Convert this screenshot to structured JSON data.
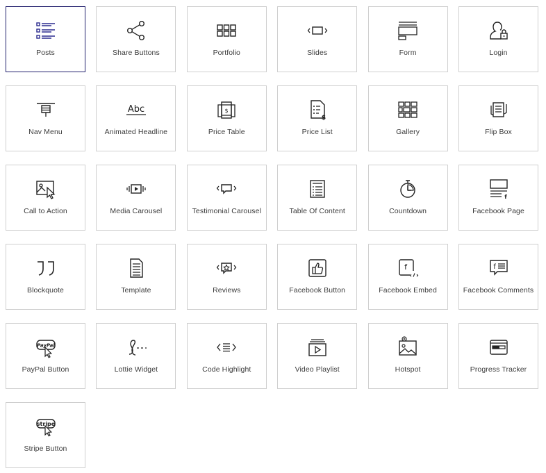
{
  "widgets": [
    {
      "label": "Posts",
      "icon": "posts-icon",
      "selected": true
    },
    {
      "label": "Share Buttons",
      "icon": "share-icon"
    },
    {
      "label": "Portfolio",
      "icon": "portfolio-grid-icon"
    },
    {
      "label": "Slides",
      "icon": "slides-icon"
    },
    {
      "label": "Form",
      "icon": "form-icon"
    },
    {
      "label": "Login",
      "icon": "login-user-lock-icon"
    },
    {
      "label": "Nav Menu",
      "icon": "nav-menu-icon"
    },
    {
      "label": "Animated Headline",
      "icon": "animated-headline-icon",
      "icon_text": "Abc"
    },
    {
      "label": "Price Table",
      "icon": "price-table-icon"
    },
    {
      "label": "Price List",
      "icon": "price-list-icon"
    },
    {
      "label": "Gallery",
      "icon": "gallery-icon"
    },
    {
      "label": "Flip Box",
      "icon": "flip-box-icon"
    },
    {
      "label": "Call to Action",
      "icon": "call-to-action-icon"
    },
    {
      "label": "Media Carousel",
      "icon": "media-carousel-icon"
    },
    {
      "label": "Testimonial Carousel",
      "icon": "testimonial-carousel-icon"
    },
    {
      "label": "Table Of Content",
      "icon": "table-of-content-icon"
    },
    {
      "label": "Countdown",
      "icon": "countdown-icon"
    },
    {
      "label": "Facebook Page",
      "icon": "facebook-page-icon"
    },
    {
      "label": "Blockquote",
      "icon": "blockquote-icon"
    },
    {
      "label": "Template",
      "icon": "template-icon"
    },
    {
      "label": "Reviews",
      "icon": "reviews-icon"
    },
    {
      "label": "Facebook Button",
      "icon": "facebook-like-icon"
    },
    {
      "label": "Facebook Embed",
      "icon": "facebook-embed-icon"
    },
    {
      "label": "Facebook Comments",
      "icon": "facebook-comments-icon"
    },
    {
      "label": "PayPal Button",
      "icon": "paypal-button-icon",
      "icon_text": "PayPal"
    },
    {
      "label": "Lottie Widget",
      "icon": "lottie-icon"
    },
    {
      "label": "Code Highlight",
      "icon": "code-highlight-icon"
    },
    {
      "label": "Video Playlist",
      "icon": "video-playlist-icon"
    },
    {
      "label": "Hotspot",
      "icon": "hotspot-icon"
    },
    {
      "label": "Progress Tracker",
      "icon": "progress-tracker-icon"
    },
    {
      "label": "Stripe Button",
      "icon": "stripe-button-icon",
      "icon_text": "stripe"
    }
  ],
  "colors": {
    "tile_border": "#cfcfcf",
    "selected_border": "#1f1d6b",
    "selected_icon": "#2b2b8f",
    "icon": "#222222",
    "label": "#3b3b3b"
  }
}
